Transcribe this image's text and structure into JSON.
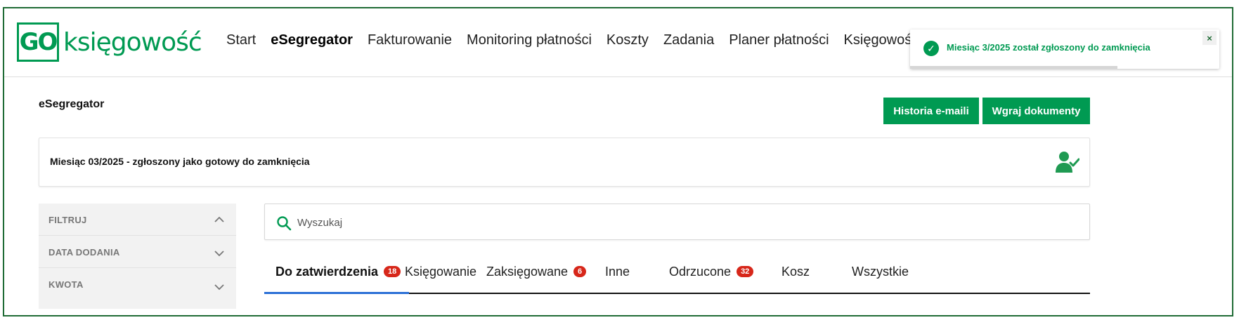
{
  "logo": {
    "box_text": "GO",
    "text": "księgowość",
    "brand_color": "#009a52"
  },
  "nav": {
    "items": [
      {
        "label": "Start",
        "active": false
      },
      {
        "label": "eSegregator",
        "active": true
      },
      {
        "label": "Fakturowanie",
        "active": false
      },
      {
        "label": "Monitoring płatności",
        "active": false
      },
      {
        "label": "Koszty",
        "active": false
      },
      {
        "label": "Zadania",
        "active": false
      },
      {
        "label": "Planer płatności",
        "active": false
      },
      {
        "label": "Księgowość",
        "active": false
      }
    ]
  },
  "toast": {
    "message": "Miesiąc 3/2025 został zgłoszony do zamknięcia",
    "icon": "check-circle-icon",
    "close_label": "×"
  },
  "page": {
    "title": "eSegregator",
    "history_button": "Historia e-maili",
    "upload_button": "Wgraj dokumenty"
  },
  "status": {
    "text": "Miesiąc 03/2025 - zgłoszony jako gotowy do zamknięcia",
    "icon": "user-check-icon"
  },
  "filters": {
    "items": [
      {
        "label": "FILTRUJ",
        "expanded": true
      },
      {
        "label": "DATA DODANIA",
        "expanded": false
      },
      {
        "label": "KWOTA",
        "expanded": false
      }
    ]
  },
  "search": {
    "placeholder": "Wyszukaj",
    "value": ""
  },
  "tabs": {
    "items": [
      {
        "label": "Do zatwierdzenia",
        "badge": "18",
        "active": true
      },
      {
        "label": "Księgowanie",
        "badge": "",
        "active": false
      },
      {
        "label": "Zaksięgowane",
        "badge": "6",
        "active": false
      },
      {
        "label": "Inne",
        "badge": "",
        "active": false
      },
      {
        "label": "Odrzucone",
        "badge": "32",
        "active": false
      },
      {
        "label": "Kosz",
        "badge": "",
        "active": false
      },
      {
        "label": "Wszystkie",
        "badge": "",
        "active": false
      }
    ]
  }
}
